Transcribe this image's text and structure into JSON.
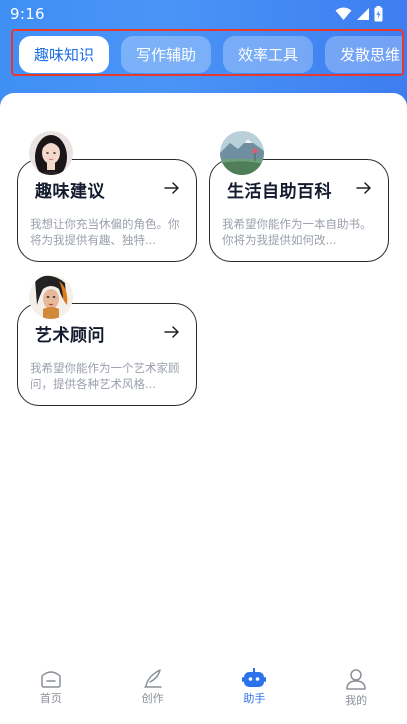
{
  "status": {
    "time": "9:16"
  },
  "tabs": [
    {
      "label": "趣味知识",
      "active": true
    },
    {
      "label": "写作辅助",
      "active": false
    },
    {
      "label": "效率工具",
      "active": false
    },
    {
      "label": "发散思维",
      "active": false
    }
  ],
  "cards": [
    {
      "title": "趣味建议",
      "description": "我想让你充当休偏的角色。你将为我提供有趣、独特...",
      "avatar": "woman-portrait"
    },
    {
      "title": "生活自助百科",
      "description": "我希望你能作为一本自助书。你将为我提供如何改...",
      "avatar": "mountain-lake"
    },
    {
      "title": "艺术顾问",
      "description": "我希望你能作为一个艺术家顾问，提供各种艺术风格...",
      "avatar": "artistic-portrait"
    }
  ],
  "nav": [
    {
      "label": "首页",
      "icon": "home-icon",
      "active": false
    },
    {
      "label": "创作",
      "icon": "quill-icon",
      "active": false
    },
    {
      "label": "助手",
      "icon": "robot-icon",
      "active": true
    },
    {
      "label": "我的",
      "icon": "user-icon",
      "active": false
    }
  ],
  "colors": {
    "accent": "#2b73ea",
    "highlight_border": "#e8392f",
    "header_gradient_start": "#3f8ff5",
    "header_gradient_end": "#3d7df0"
  }
}
